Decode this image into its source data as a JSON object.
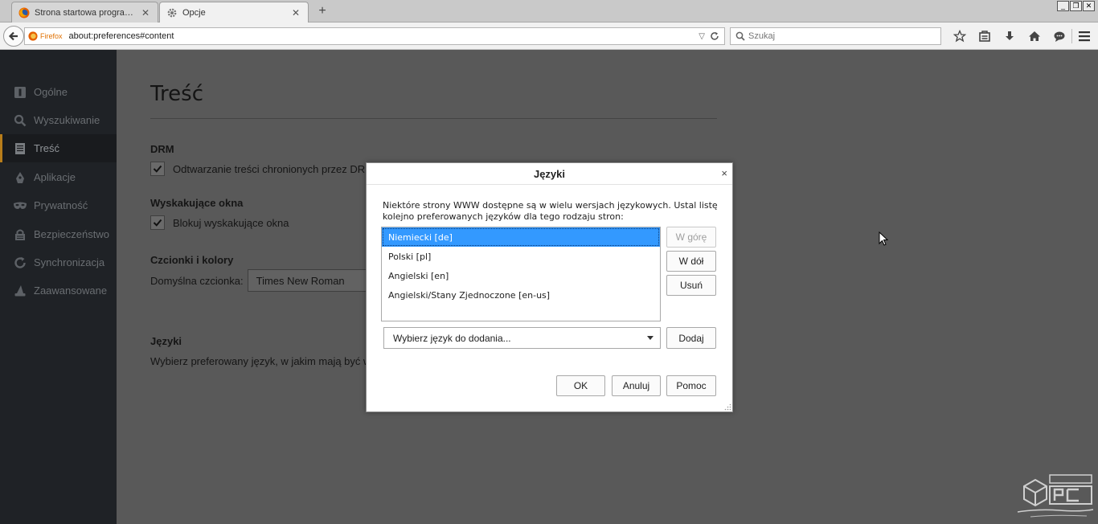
{
  "browser": {
    "tabs": [
      {
        "label": "Strona startowa programu M...",
        "active": false
      },
      {
        "label": "Opcje",
        "active": true
      }
    ],
    "new_tab_glyph": "+",
    "window_controls": [
      "_",
      "❐",
      "✕"
    ],
    "identity_label": "Firefox",
    "url": "about:preferences#content",
    "search_placeholder": "Szukaj",
    "toolbar_icons": [
      "bookmark-star-icon",
      "reading-list-icon",
      "downloads-icon",
      "home-icon",
      "chat-icon",
      "menu-icon"
    ]
  },
  "sidebar": {
    "items": [
      {
        "label": "Ogólne",
        "icon": "general-icon",
        "selected": false
      },
      {
        "label": "Wyszukiwanie",
        "icon": "search-icon",
        "selected": false
      },
      {
        "label": "Treść",
        "icon": "content-icon",
        "selected": true
      },
      {
        "label": "Aplikacje",
        "icon": "applications-icon",
        "selected": false
      },
      {
        "label": "Prywatność",
        "icon": "privacy-mask-icon",
        "selected": false
      },
      {
        "label": "Bezpieczeństwo",
        "icon": "security-lock-icon",
        "selected": false
      },
      {
        "label": "Synchronizacja",
        "icon": "sync-icon",
        "selected": false
      },
      {
        "label": "Zaawansowane",
        "icon": "advanced-wizard-icon",
        "selected": false
      }
    ]
  },
  "content": {
    "title": "Treść",
    "drm": {
      "heading": "DRM",
      "checkbox_label": "Odtwarzanie treści chronionych przez DRM",
      "checked": true
    },
    "popups": {
      "heading": "Wyskakujące okna",
      "checkbox_label": "Blokuj wyskakujące okna",
      "checked": true
    },
    "fonts": {
      "heading": "Czcionki i kolory",
      "default_font_label": "Domyślna czcionka:",
      "default_font_value": "Times New Roman"
    },
    "languages": {
      "heading": "Języki",
      "description": "Wybierz preferowany język, w jakim mają być wy"
    }
  },
  "dialog": {
    "title": "Języki",
    "close_glyph": "×",
    "description": "Niektóre strony WWW dostępne są w wielu wersjach językowych. Ustal listę kolejno preferowanych języków dla tego rodzaju stron:",
    "languages": [
      {
        "label": "Niemiecki  [de]",
        "selected": true
      },
      {
        "label": "Polski  [pl]",
        "selected": false
      },
      {
        "label": "Angielski  [en]",
        "selected": false
      },
      {
        "label": "Angielski/Stany Zjednoczone  [en-us]",
        "selected": false
      }
    ],
    "move_up_label": "W górę",
    "move_down_label": "W dół",
    "remove_label": "Usuń",
    "add_select_placeholder": "Wybierz język do dodania...",
    "add_label": "Dodaj",
    "ok_label": "OK",
    "cancel_label": "Anuluj",
    "help_label": "Pomoc"
  },
  "colors": {
    "selection": "#3399ff",
    "sidebar_bg": "#1f2226",
    "sidebar_accent": "#b87d1a",
    "firefox_orange": "#e07000"
  }
}
